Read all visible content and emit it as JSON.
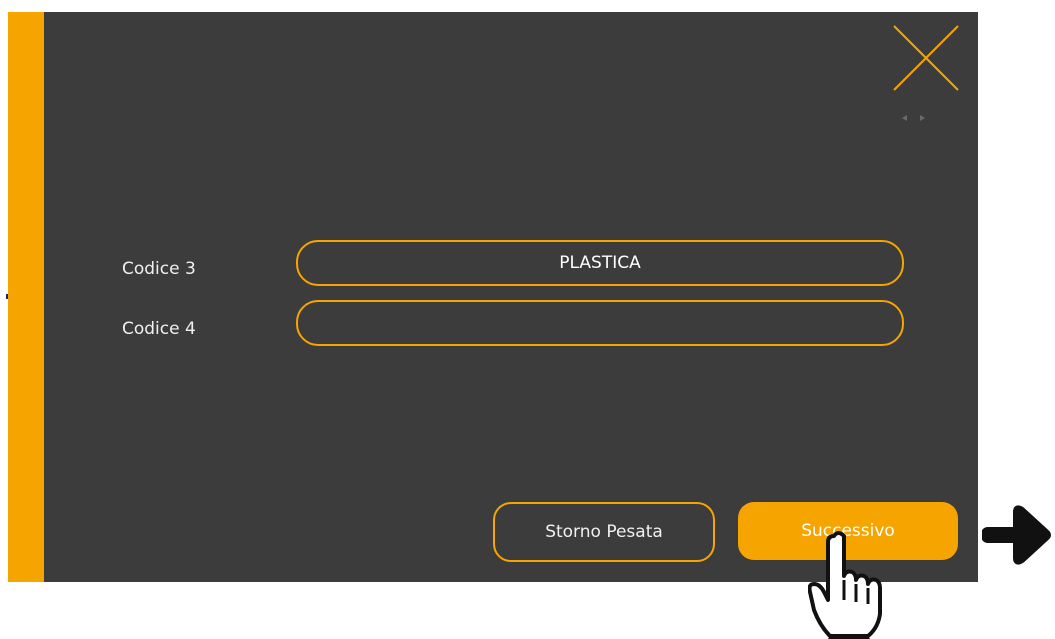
{
  "window": {
    "close_icon": "close-x-icon",
    "nav_icon": "small-left-right-arrows-icon"
  },
  "form": {
    "fields": [
      {
        "label": "Codice 3",
        "value": "PLASTICA"
      },
      {
        "label": "Codice 4",
        "value": ""
      }
    ]
  },
  "footer": {
    "cancel_label": "Storno Pesata",
    "next_label": "Successivo"
  },
  "overlay": {
    "arrow_icon": "right-arrow-icon",
    "pointer_icon": "hand-pointer-icon"
  },
  "colors": {
    "accent": "#f6a500",
    "panel": "#3c3c3c",
    "text": "#f0f0f0"
  }
}
